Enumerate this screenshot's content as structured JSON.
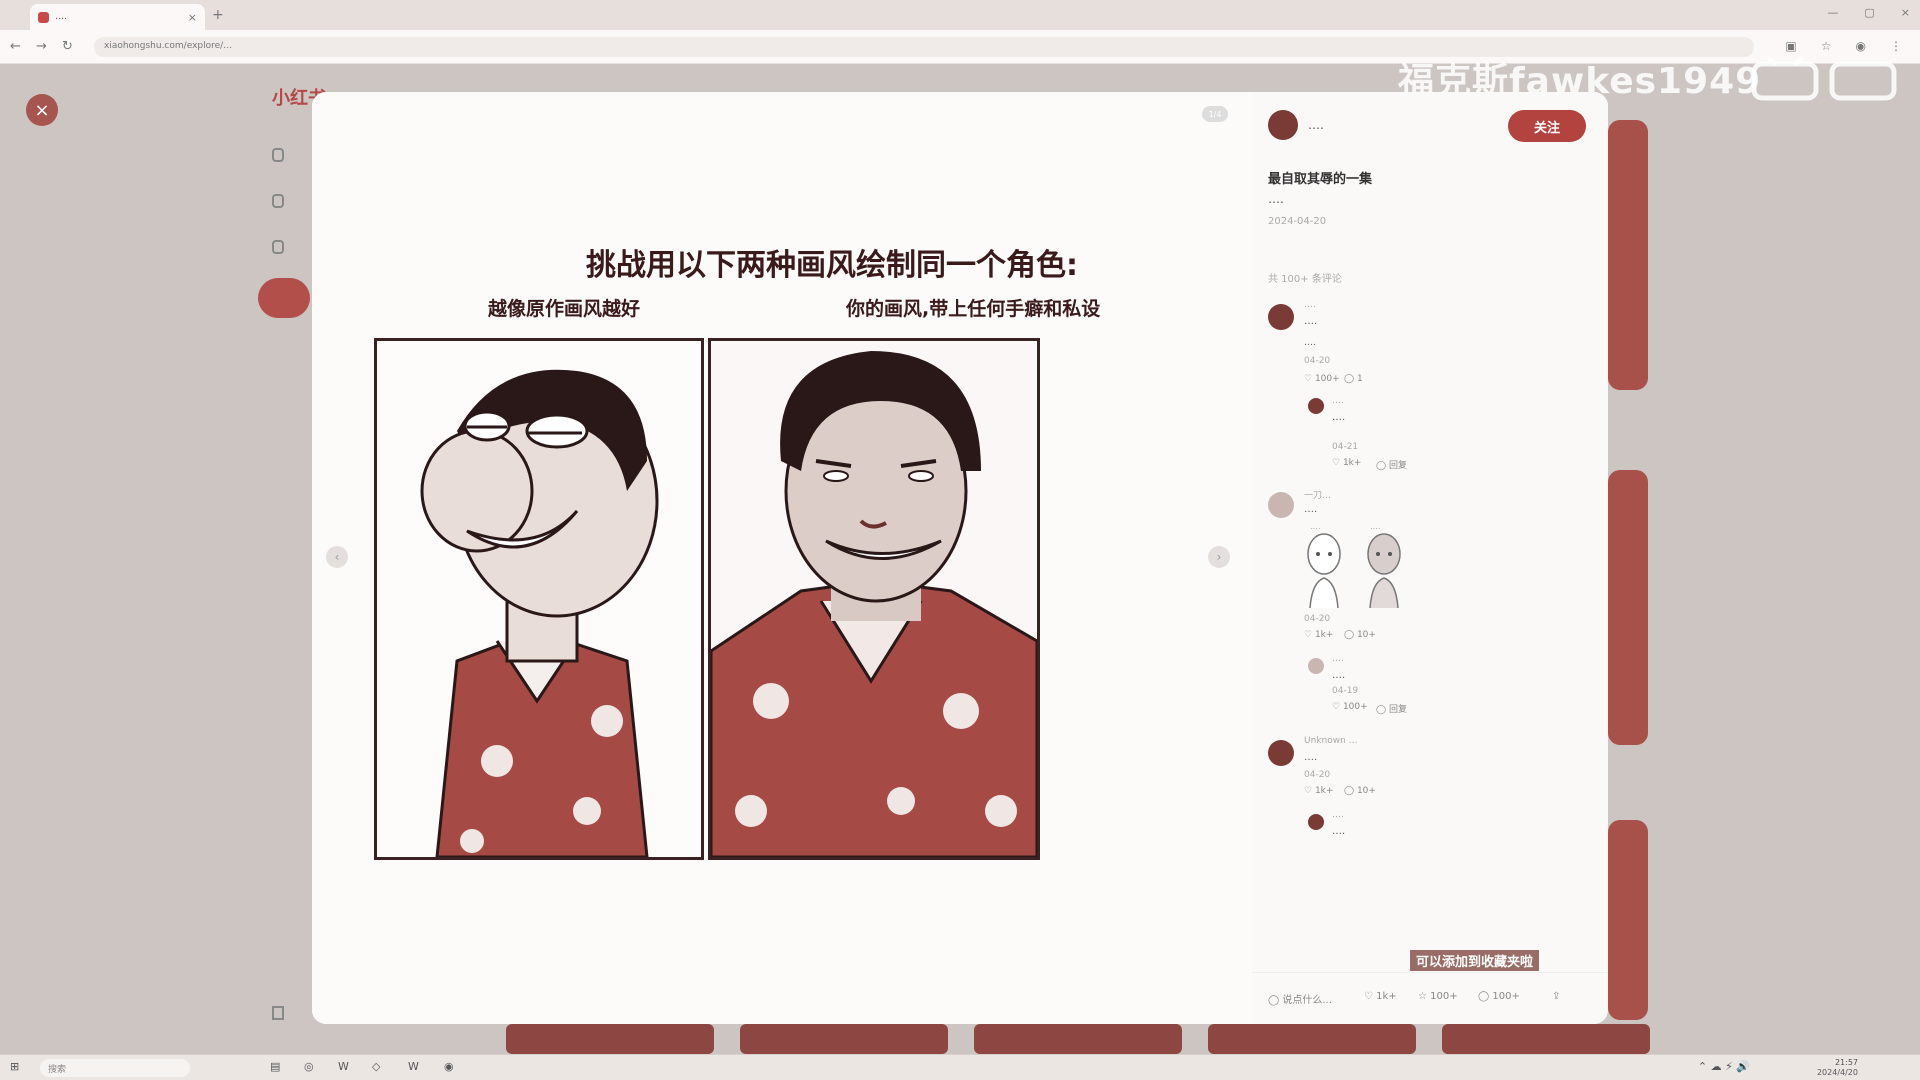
{
  "browser": {
    "tab_title": "….",
    "tab_close": "×",
    "new_tab": "+",
    "url": "xiaohongshu.com/explore/…",
    "window_controls": [
      "—",
      "▢",
      "×"
    ]
  },
  "watermark": {
    "channel": "福克斯fawkes1949",
    "logo": "bilibili"
  },
  "background_page": {
    "logo": "小红书"
  },
  "modal": {
    "image_counter": "1/4",
    "comic": {
      "title": "挑战用以下两种画风绘制同一个角色:",
      "left_caption": "越像原作画风越好",
      "right_caption": "你的画风,带上任何手癖和私设"
    },
    "author": {
      "name": "….",
      "follow_label": "关注"
    },
    "post": {
      "title": "最自取其辱的一集",
      "description": "….",
      "date": "2024-04-20"
    },
    "comment_count": "共 100+ 条评论",
    "comments": [
      {
        "user": "….",
        "text": "….",
        "extra": "….",
        "time": "04-20",
        "likes": "100+",
        "replies": "1"
      },
      {
        "user": "….",
        "text": "….",
        "extra": "",
        "time": "04-21",
        "likes": "1k+",
        "replies": "回复"
      },
      {
        "user": "一刀…",
        "text": "….",
        "extra": "",
        "time": "04-20",
        "likes": "1k+",
        "replies": "10+"
      },
      {
        "user": "….",
        "text": "….",
        "extra": "",
        "time": "04-19",
        "likes": "100+",
        "replies": "回复"
      },
      {
        "user": "Unknown …",
        "text": "….",
        "extra": "",
        "time": "04-20",
        "likes": "1k+",
        "replies": "10+"
      },
      {
        "user": "….",
        "text": "….",
        "extra": "",
        "time": "",
        "likes": "",
        "replies": ""
      }
    ],
    "reply_sketch_labels": [
      "….",
      "…."
    ],
    "bottom_bar": {
      "input_placeholder": "说点什么...",
      "likes": "1k+",
      "stars": "100+",
      "comments": "100+"
    }
  },
  "video_subtitle": "可以添加到收藏夹啦",
  "taskbar": {
    "search_placeholder": "搜索",
    "time": "21:57",
    "date": "2024/4/20"
  },
  "colors": {
    "accent": "#b3433e",
    "ink": "#3a2222",
    "shirt": "#a64a45"
  }
}
